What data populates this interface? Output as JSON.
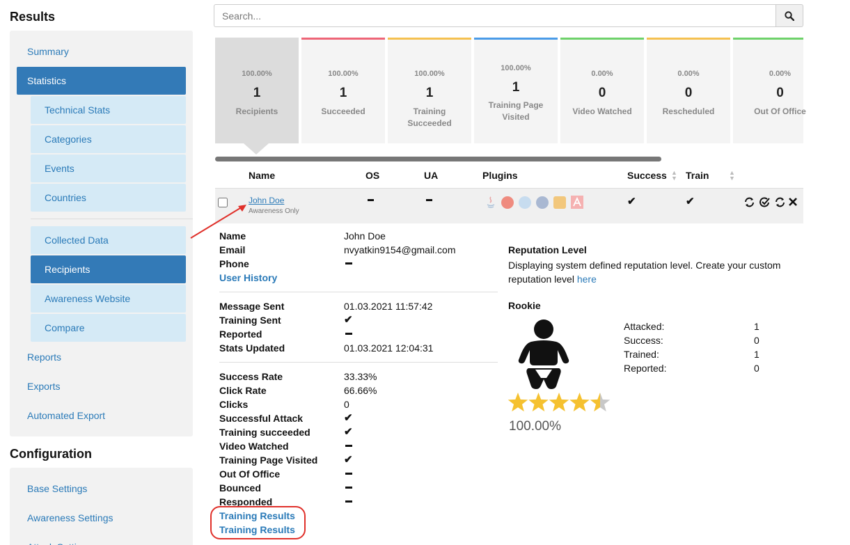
{
  "sidebar": {
    "results_title": "Results",
    "results_items": [
      {
        "label": "Summary"
      },
      {
        "label": "Statistics"
      },
      {
        "label": "Technical Stats"
      },
      {
        "label": "Categories"
      },
      {
        "label": "Events"
      },
      {
        "label": "Countries"
      },
      {
        "label": "Collected Data"
      },
      {
        "label": "Recipients"
      },
      {
        "label": "Awareness Website"
      },
      {
        "label": "Compare"
      },
      {
        "label": "Reports"
      },
      {
        "label": "Exports"
      },
      {
        "label": "Automated Export"
      }
    ],
    "config_title": "Configuration",
    "config_items": [
      {
        "label": "Base Settings"
      },
      {
        "label": "Awareness Settings"
      },
      {
        "label": "Attack Settings"
      }
    ]
  },
  "search": {
    "placeholder": "Search...",
    "icon": "search-icon"
  },
  "stats": [
    {
      "pct": "100.00%",
      "value": "1",
      "label": "Recipients",
      "color": "#dcdcdc"
    },
    {
      "pct": "100.00%",
      "value": "1",
      "label": "Succeeded",
      "color": "#ee6577"
    },
    {
      "pct": "100.00%",
      "value": "1",
      "label": "Training Succeeded",
      "color": "#f5c150"
    },
    {
      "pct": "100.00%",
      "value": "1",
      "label": "Training Page Visited",
      "color": "#4a9be8"
    },
    {
      "pct": "0.00%",
      "value": "0",
      "label": "Video Watched",
      "color": "#6ed26a"
    },
    {
      "pct": "0.00%",
      "value": "0",
      "label": "Rescheduled",
      "color": "#f5c150"
    },
    {
      "pct": "0.00%",
      "value": "0",
      "label": "Out Of Office",
      "color": "#6ed26a"
    }
  ],
  "table": {
    "headers": {
      "name": "Name",
      "os": "OS",
      "ua": "UA",
      "plugins": "Plugins",
      "success": "Success",
      "train": "Train"
    },
    "row": {
      "name": "John Doe",
      "subtitle": "Awareness Only"
    }
  },
  "detail": {
    "name_label": "Name",
    "name_value": "John Doe",
    "email_label": "Email",
    "email_value": "nvyatkin9154@gmail.com",
    "phone_label": "Phone",
    "user_history": "User History",
    "message_sent_label": "Message Sent",
    "message_sent_value": "01.03.2021 11:57:42",
    "training_sent_label": "Training Sent",
    "reported_label": "Reported",
    "stats_updated_label": "Stats Updated",
    "stats_updated_value": "01.03.2021 12:04:31",
    "success_rate_label": "Success Rate",
    "success_rate_value": "33.33%",
    "click_rate_label": "Click Rate",
    "click_rate_value": "66.66%",
    "clicks_label": "Clicks",
    "clicks_value": "0",
    "successful_attack_label": "Successful Attack",
    "training_succeeded_label": "Training succeeded",
    "video_watched_label": "Video Watched",
    "training_page_visited_label": "Training Page Visited",
    "out_of_office_label": "Out Of Office",
    "bounced_label": "Bounced",
    "responded_label": "Responded",
    "training_results_1": "Training Results",
    "training_results_2": "Training Results"
  },
  "reputation": {
    "title": "Reputation Level",
    "text": "Displaying system defined reputation level. Create your custom reputation level",
    "link": "here",
    "level": "Rookie",
    "stars": 4.5,
    "percent": "100.00%",
    "stats": [
      {
        "label": "Attacked:",
        "value": "1"
      },
      {
        "label": "Success:",
        "value": "0"
      },
      {
        "label": "Trained:",
        "value": "1"
      },
      {
        "label": "Reported:",
        "value": "0"
      }
    ]
  }
}
